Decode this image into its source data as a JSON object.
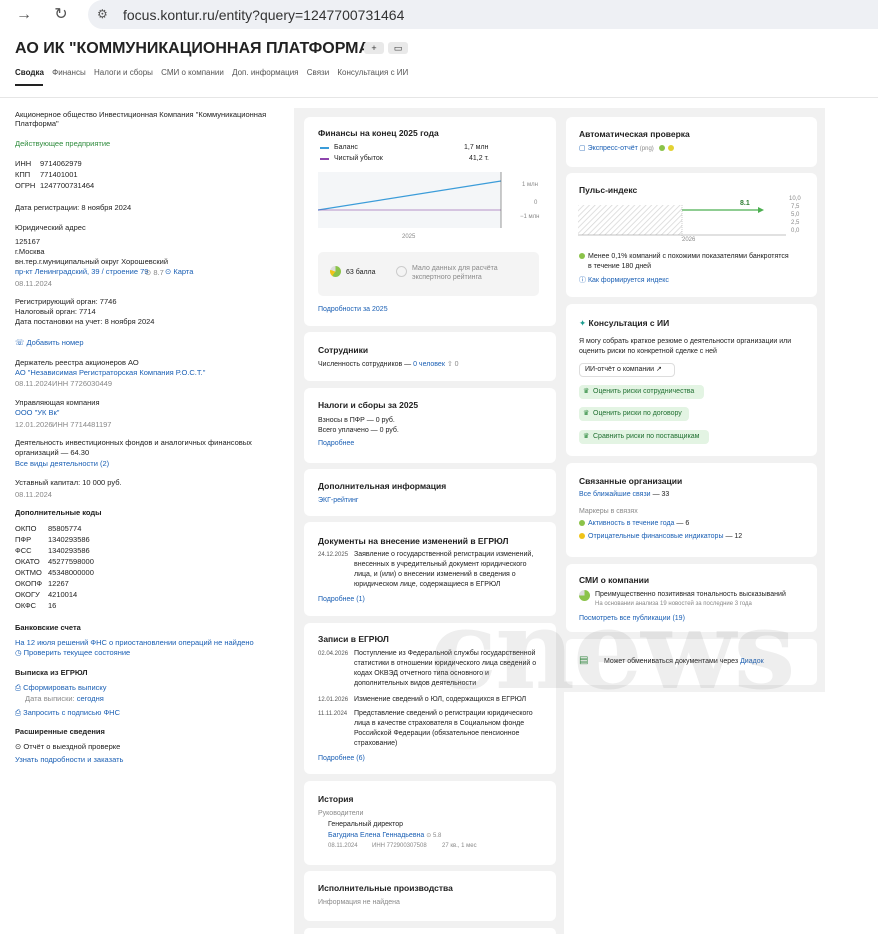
{
  "browser": {
    "url": "focus.kontur.ru/entity?query=1247700731464"
  },
  "header": {
    "title": "АО ИК \"КОММУНИКАЦИОННАЯ ПЛАТФОРМА\"",
    "plus": "+",
    "tabs": [
      "Сводка",
      "Финансы",
      "Налоги и сборы",
      "СМИ о компании",
      "Доп. информация",
      "Связи",
      "Консультация с ИИ"
    ]
  },
  "left": {
    "fullname1": "Акционерное общество Инвестиционная Компания \"Коммуникационная",
    "fullname2": "Платформа\"",
    "status": "Действующее предприятие",
    "inn_l": "ИНН",
    "inn": "9714062979",
    "kpp_l": "КПП",
    "kpp": "771401001",
    "ogrn_l": "ОГРН",
    "ogrn": "1247700731464",
    "regdate": "Дата регистрации: 8 ноября 2024",
    "addr_h": "Юридический адрес",
    "addr1": "125167",
    "addr2": "г.Москва",
    "addr3": "вн.тер.г.муниципальный округ Хорошевский",
    "addr4": "пр-кт Ленинградский, 39 / строение 79",
    "addr_badge": "8.7",
    "map": "Карта",
    "addr_date": "08.11.2024",
    "reg1": "Регистрирующий орган: 7746",
    "reg2": "Налоговый орган: 7714",
    "reg3": "Дата постановки на учет: 8 ноября 2024",
    "phone": "Добавить номер",
    "holder_h": "Держатель реестра акционеров АО",
    "holder": "АО \"Независимая Регистраторская Компания Р.О.С.Т.\"",
    "holder_date": "08.11.2024",
    "holder_inn": "ИНН 7726030449",
    "mgmt_h": "Управляющая компания",
    "mgmt": "ООО \"УК Вк\"",
    "mgmt_date": "12.01.2026",
    "mgmt_inn": "ИНН 7714481197",
    "act1": "Деятельность инвестиционных фондов и аналогичных финансовых",
    "act2": "организаций — 64.30",
    "act_all": "Все виды деятельности (2)",
    "cap": "Уставный капитал: 10 000 руб.",
    "cap_date": "08.11.2024",
    "codes_h": "Дополнительные коды",
    "codes": [
      {
        "k": "ОКПО",
        "v": "85805774"
      },
      {
        "k": "ПФР",
        "v": "1340293586"
      },
      {
        "k": "ФСС",
        "v": "1340293586"
      },
      {
        "k": "ОКАТО",
        "v": "45277598000"
      },
      {
        "k": "ОКТМО",
        "v": "45348000000"
      },
      {
        "k": "ОКОПФ",
        "v": "12267"
      },
      {
        "k": "ОКОГУ",
        "v": "4210014"
      },
      {
        "k": "ОКФС",
        "v": "16"
      }
    ],
    "bank_h": "Банковские счета",
    "bank1": "На 12 июля решений ФНС о приостановлении операций не найдено",
    "bank2": "Проверить текущее состояние",
    "egr_h": "Выписка из ЕГРЮЛ",
    "egr1": "Сформировать выписку",
    "egr2": "Дата выписки:",
    "egr2b": "сегодня",
    "egr3": "Запросить с подписью ФНС",
    "ext_h": "Расширенные сведения",
    "ext1": "Отчёт о выездной проверке",
    "ext2": "Узнать подробности и заказать"
  },
  "fin": {
    "title": "Финансы на конец 2025 года",
    "bal_l": "Баланс",
    "bal_v": "1,7 млн",
    "loss_l": "Чистый убыток",
    "loss_v": "41,2 т.",
    "y1": "1 млн",
    "y0": "0",
    "y2": "−1 млн",
    "x": "2025",
    "score": "63 балла",
    "score_note1": "Мало данных для расчёта",
    "score_note2": "экспертного рейтинга",
    "more": "Подробности за 2025",
    "colors": {
      "balance": "#3b9cd9",
      "loss": "#8e44ad"
    }
  },
  "staff": {
    "title": "Сотрудники",
    "text": "Численность сотрудников —",
    "val": "0 человек",
    "badge": "0"
  },
  "tax": {
    "title": "Налоги и сборы за 2025",
    "l1": "Взносы в ПФР — 0 руб.",
    "l2": "Всего уплачено — 0 руб.",
    "more": "Подробнее"
  },
  "extra": {
    "title": "Дополнительная информация",
    "link": "ЭКГ-рейтинг"
  },
  "docs": {
    "title": "Документы на внесение изменений в ЕГРЮЛ",
    "date": "24.12.2025",
    "l1": "Заявление о государственной регистрации изменений,",
    "l2": "внесенных в учредительный документ юридического",
    "l3": "лица, и (или) о внесении изменений в сведения о",
    "l4": "юридическом лице, содержащиеся в ЕГРЮЛ",
    "more": "Подробнее (1)"
  },
  "rec": {
    "title": "Записи в ЕГРЮЛ",
    "d1": "02.04.2026",
    "a1": "Поступление из Федеральной службы государственной",
    "a2": "статистики в отношении юридического лица сведений о",
    "a3": "кодах ОКВЭД отчетного типа основного и",
    "a4": "дополнительных видов деятельности",
    "d2": "12.01.2026",
    "b1": "Изменение сведений о ЮЛ, содержащихся в ЕГРЮЛ",
    "d3": "11.11.2024",
    "c1": "Представление сведений о регистрации юридического",
    "c2": "лица в качестве страхователя в Социальном фонде",
    "c3": "Российской Федерации (обязательное пенсионное",
    "c4": "страхование)",
    "more": "Подробнее (6)"
  },
  "hist": {
    "title": "История",
    "sub": "Руководители",
    "pos": "Генеральный директор",
    "name": "Багудина Елена Геннадьевна",
    "badge": "5.8",
    "date": "08.11.2024",
    "inn": "ИНН 772900307508",
    "term": "27 кв., 1 мес"
  },
  "exec": {
    "title": "Исполнительные производства",
    "text": "Информация не найдена"
  },
  "auto": {
    "title": "Автоматическая проверка",
    "link": "Экспресс-отчёт",
    "tag": "(png)"
  },
  "pulse": {
    "title": "Пульс-индекс",
    "ticks": [
      "10,0",
      "7,5",
      "5,0",
      "2,5",
      "0,0"
    ],
    "val": "8.1",
    "year": "2026",
    "note1": "Менее 0,1% компаний с похожими показателями банкротятся",
    "note2": "в течение 180 дней",
    "how": "Как формируется индекс"
  },
  "ai": {
    "title": "Консультация с ИИ",
    "t1": "Я могу собрать краткое резюме о деятельности организации или",
    "t2": "оценить риски по конкретной сделке с ней",
    "btn0": "ИИ-отчёт о компании",
    "btn1": "Оценить риски сотрудничества",
    "btn2": "Оценить риски по договору",
    "btn3": "Сравнить риски по поставщикам"
  },
  "rel": {
    "title": "Связанные организации",
    "l1": "Все ближайшие связи",
    "v1": "— 33",
    "sub": "Маркеры в связях",
    "m1": "Активность в течение года",
    "mv1": "— 6",
    "m2": "Отрицательные финансовые индикаторы",
    "mv2": "— 12"
  },
  "smi": {
    "title": "СМИ о компании",
    "l1": "Преимущественно позитивная тональность высказываний",
    "l2": "На основании анализа 19 новостей за последние 3 года",
    "more": "Посмотреть все публикации (19)"
  },
  "diadoc": {
    "text": "Может обмениваться документами через",
    "link": "Диадок"
  },
  "watermark": "cnews"
}
